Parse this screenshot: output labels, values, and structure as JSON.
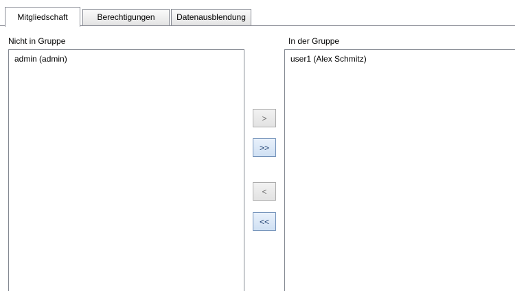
{
  "tabs": [
    {
      "label": "Mitgliedschaft",
      "active": true
    },
    {
      "label": "Berechtigungen",
      "active": false
    },
    {
      "label": "Datenausblendung",
      "active": false
    }
  ],
  "left_list": {
    "label": "Nicht in Gruppe",
    "items": [
      "admin (admin)"
    ]
  },
  "right_list": {
    "label": "In der Gruppe",
    "items": [
      "user1 (Alex Schmitz)"
    ]
  },
  "buttons": {
    "add_selected": ">",
    "add_all": ">>",
    "remove_selected": "<",
    "remove_all": "<<"
  },
  "colors": {
    "border": "#898c95",
    "button_enabled_border": "#6f8fb8",
    "button_enabled_text": "#1a3c6e",
    "button_disabled_text": "#6d6d6d"
  }
}
